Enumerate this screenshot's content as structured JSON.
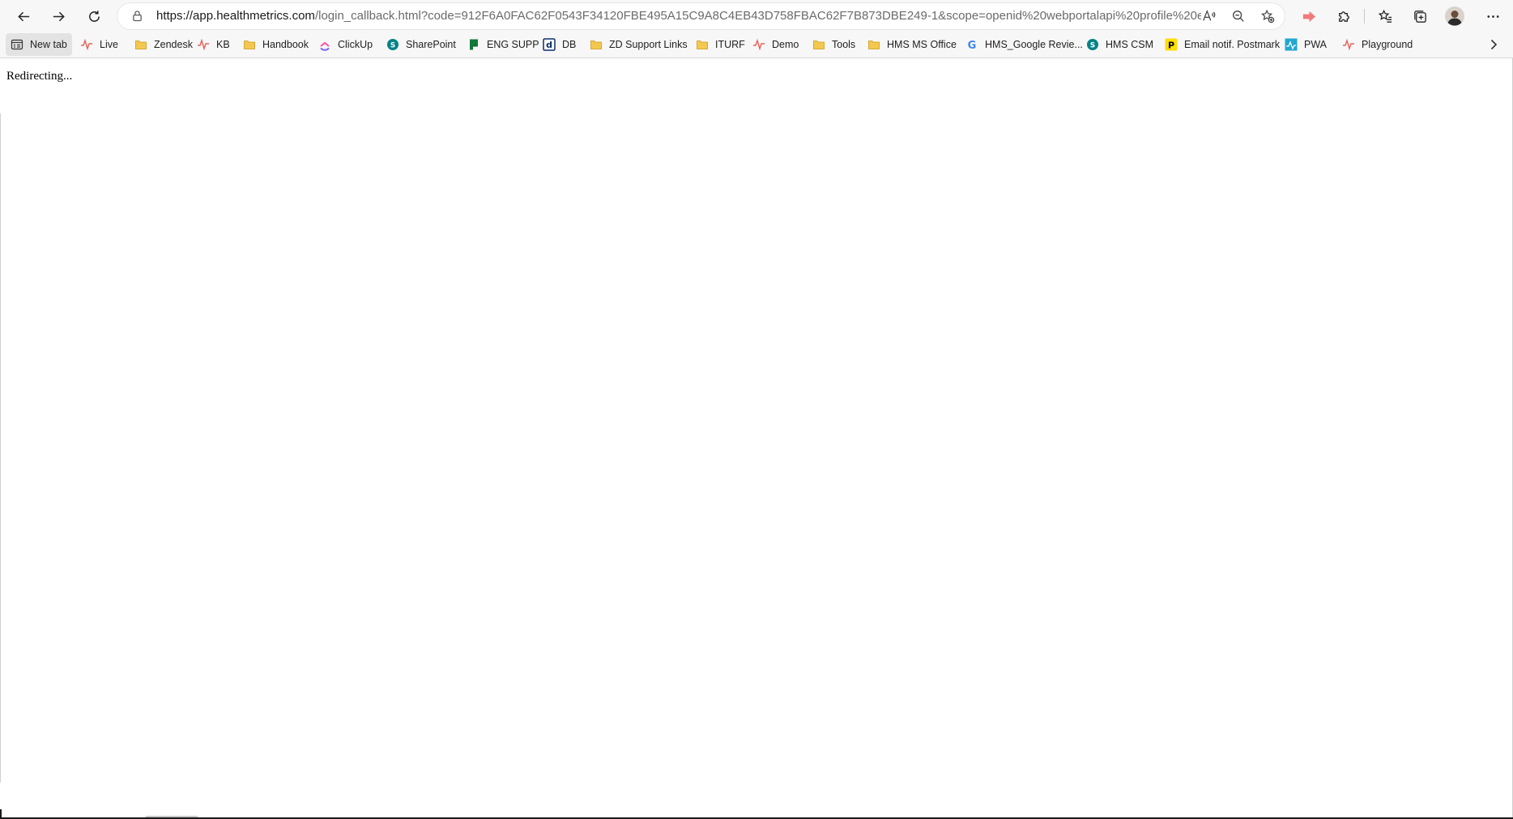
{
  "browser": {
    "url_host": "https://app.healthmetrics.com",
    "url_rest": "/login_callback.html?code=912F6A0FAC62F0543F34120FBE495A15C9A8C4EB43D758FBAC62F7B873DBE249-1&scope=openid%20webportalapi%20profile%20email%20address..."
  },
  "bookmarks": [
    {
      "label": "New tab",
      "icon": "new-tab-icon"
    },
    {
      "label": "Live",
      "icon": "pulse-icon"
    },
    {
      "label": "Zendesk",
      "icon": "folder-icon"
    },
    {
      "label": "KB",
      "icon": "pulse-icon"
    },
    {
      "label": "Handbook",
      "icon": "folder-icon"
    },
    {
      "label": "ClickUp",
      "icon": "clickup-icon"
    },
    {
      "label": "SharePoint",
      "icon": "sharepoint-icon"
    },
    {
      "label": "ENG SUPP",
      "icon": "eng-flag-icon"
    },
    {
      "label": "DB",
      "icon": "db-icon"
    },
    {
      "label": "ZD Support Links",
      "icon": "folder-icon"
    },
    {
      "label": "ITURF",
      "icon": "folder-icon"
    },
    {
      "label": "Demo",
      "icon": "pulse-icon"
    },
    {
      "label": "Tools",
      "icon": "folder-icon"
    },
    {
      "label": "HMS MS Office",
      "icon": "folder-icon"
    },
    {
      "label": "HMS_Google Revie...",
      "icon": "google-icon"
    },
    {
      "label": "HMS CSM",
      "icon": "sharepoint-icon"
    },
    {
      "label": "Email notif. Postmark",
      "icon": "postmark-icon"
    },
    {
      "label": "PWA",
      "icon": "pwa-icon"
    },
    {
      "label": "Playground",
      "icon": "pulse-icon"
    }
  ],
  "page": {
    "status_text": "Redirecting..."
  },
  "colors": {
    "folder": "#f4c84f",
    "pulse": "#e8605a",
    "sharepoint": "#038387",
    "eng": "#0f7a3a",
    "postmark": "#ffde00",
    "pwa": "#22a7d0"
  }
}
